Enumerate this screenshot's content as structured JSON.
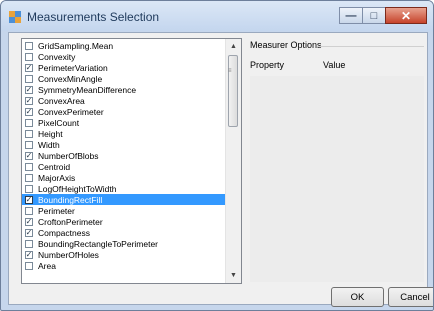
{
  "window": {
    "title": "Measurements Selection"
  },
  "title_buttons": {
    "minimize": "—",
    "maximize": "□",
    "close": "✕"
  },
  "measurements": [
    {
      "label": "GridSampling.Mean",
      "checked": false,
      "selected": false
    },
    {
      "label": "Convexity",
      "checked": false,
      "selected": false
    },
    {
      "label": "PerimeterVariation",
      "checked": true,
      "selected": false
    },
    {
      "label": "ConvexMinAngle",
      "checked": false,
      "selected": false
    },
    {
      "label": "SymmetryMeanDifference",
      "checked": true,
      "selected": false
    },
    {
      "label": "ConvexArea",
      "checked": true,
      "selected": false
    },
    {
      "label": "ConvexPerimeter",
      "checked": true,
      "selected": false
    },
    {
      "label": "PixelCount",
      "checked": false,
      "selected": false
    },
    {
      "label": "Height",
      "checked": false,
      "selected": false
    },
    {
      "label": "Width",
      "checked": false,
      "selected": false
    },
    {
      "label": "NumberOfBlobs",
      "checked": true,
      "selected": false
    },
    {
      "label": "Centroid",
      "checked": false,
      "selected": false
    },
    {
      "label": "MajorAxis",
      "checked": false,
      "selected": false
    },
    {
      "label": "LogOfHeightToWidth",
      "checked": false,
      "selected": false
    },
    {
      "label": "BoundingRectFill",
      "checked": true,
      "selected": true
    },
    {
      "label": "Perimeter",
      "checked": false,
      "selected": false
    },
    {
      "label": "CroftonPerimeter",
      "checked": true,
      "selected": false
    },
    {
      "label": "Compactness",
      "checked": true,
      "selected": false
    },
    {
      "label": "BoundingRectangleToPerimeter",
      "checked": false,
      "selected": false
    },
    {
      "label": "NumberOfHoles",
      "checked": true,
      "selected": false
    },
    {
      "label": "Area",
      "checked": false,
      "selected": false
    }
  ],
  "options": {
    "title": "Measurer Options",
    "columns": {
      "property": "Property",
      "value": "Value"
    }
  },
  "buttons": {
    "ok": "OK",
    "cancel": "Cancel"
  },
  "colors": {
    "selection": "#3399ff",
    "titlebar": "#c4d6ee",
    "close": "#c6432b"
  }
}
